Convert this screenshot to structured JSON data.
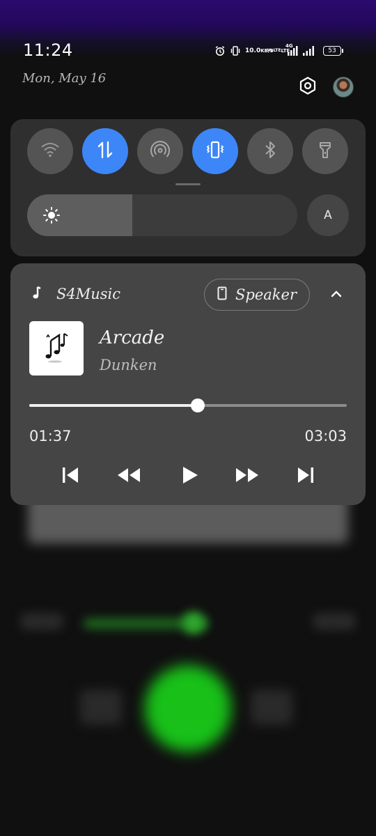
{
  "status_bar": {
    "time": "11:24",
    "date": "Mon, May 16",
    "net_speed_value": "10.0",
    "net_speed_unit": "KB/S",
    "volte_label_top": "VoLTE",
    "volte_label_bottom": "LTE",
    "signal_label": "4G",
    "battery": "53",
    "icons": [
      "alarm-icon",
      "vibrate-icon",
      "signal-icon",
      "signal-icon"
    ]
  },
  "header": {
    "settings_icon": "gear-hexagon-icon",
    "avatar": "user-avatar"
  },
  "quick_settings": {
    "tiles": [
      {
        "name": "wifi",
        "icon": "wifi-icon",
        "active": false
      },
      {
        "name": "mobile-data",
        "icon": "data-arrows-icon",
        "active": true
      },
      {
        "name": "hotspot",
        "icon": "hotspot-icon",
        "active": false
      },
      {
        "name": "vibrate",
        "icon": "vibrate-icon",
        "active": true
      },
      {
        "name": "bluetooth",
        "icon": "bluetooth-icon",
        "active": false
      },
      {
        "name": "flashlight",
        "icon": "flashlight-icon",
        "active": false
      }
    ],
    "brightness_level": 0.39,
    "auto_brightness_label": "A",
    "accent_color": "#3d86f7"
  },
  "media": {
    "app_name": "S4Music",
    "output_label": "Speaker",
    "track_title": "Arcade",
    "track_artist": "Dunken",
    "elapsed": "01:37",
    "total": "03:03",
    "progress": 0.53
  }
}
